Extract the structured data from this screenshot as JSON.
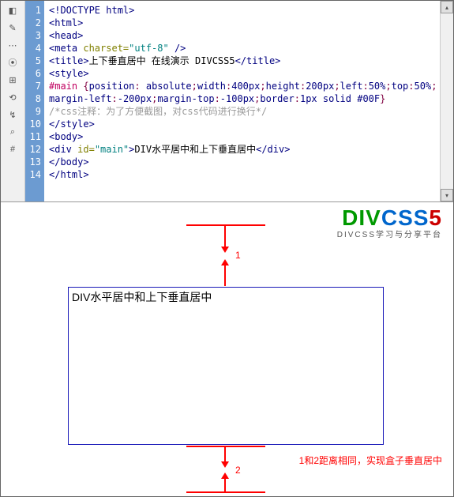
{
  "editor": {
    "line_numbers": [
      "1",
      "2",
      "3",
      "4",
      "5",
      "6",
      "7",
      "8",
      "9",
      "10",
      "11",
      "12",
      "13",
      "14"
    ],
    "l1_doctype": "<!DOCTYPE html>",
    "l2": "<html>",
    "l3": "<head>",
    "l4_open": "<meta",
    "l4_attr": " charset=",
    "l4_val": "\"utf-8\"",
    "l4_close": " />",
    "l5_open": "<title>",
    "l5_text": "上下垂直居中 在线演示 DIVCSS5",
    "l5_close": "</title>",
    "l6": "<style>",
    "l7_sel": "#main ",
    "l7_brace": "{",
    "l7_p1": "position",
    "l7_c": ": ",
    "l7_v1": "absolute",
    "l7_sc": ";",
    "l7_p2": "width",
    "l7_v2": "400px",
    "l7_p3": "height",
    "l7_v3": "200px",
    "l7_p4": "left",
    "l7_v4": "50%",
    "l7_p5": "top",
    "l7_v5": "50%",
    "l8_p1": "margin-left",
    "l8_v1": "-200px",
    "l8_p2": "margin-top",
    "l8_v2": "-100px",
    "l8_p3": "border",
    "l8_v3": "1px solid #00F",
    "l8_brace": "}",
    "l9": "/*css注释：为了方便截图，对css代码进行换行*/",
    "l10": "</style>",
    "l11": "<body>",
    "l12_open": "<div",
    "l12_attr": " id=",
    "l12_val": "\"main\"",
    "l12_gt": ">",
    "l12_text": "DIV水平居中和上下垂直居中",
    "l12_close": "</div>",
    "l13": "</body>",
    "l14": "</html>"
  },
  "logo": {
    "text_div": "DIV",
    "text_css": "CSS",
    "text_5": "5",
    "sub": "DIVCSS学习与分享平台"
  },
  "preview": {
    "num1": "1",
    "num2": "2",
    "box_text": "DIV水平居中和上下垂直居中",
    "note": "1和2距离相同，实现盒子垂直居中"
  }
}
